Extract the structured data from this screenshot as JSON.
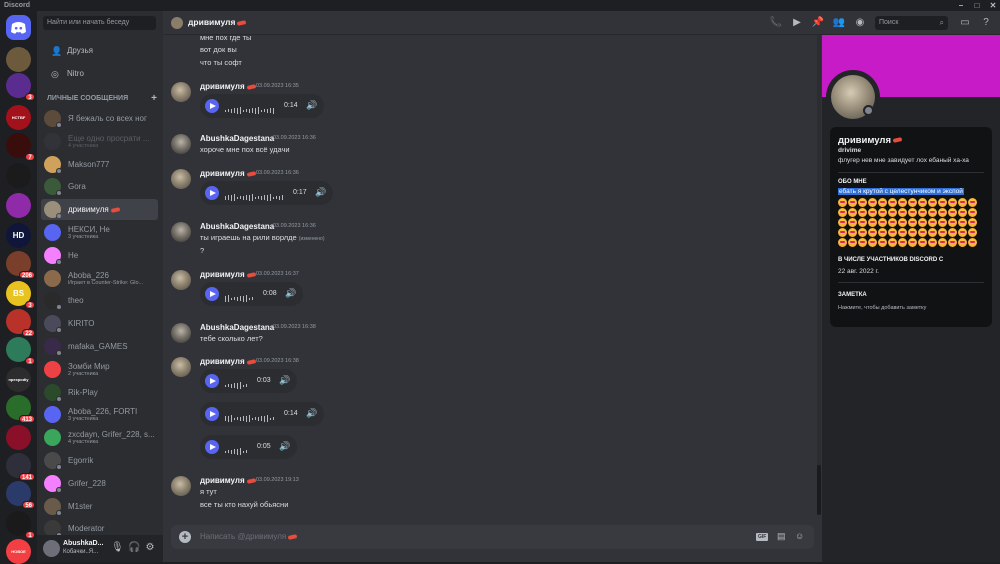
{
  "app": {
    "title": "Discord"
  },
  "servers": [
    {
      "color": "#6d5a3c",
      "badge": ""
    },
    {
      "color": "#5b2c8f",
      "badge": "3"
    },
    {
      "color": "#a3121b",
      "badge": "",
      "label": "HCTBF"
    },
    {
      "color": "#3a0d0d",
      "badge": "7"
    },
    {
      "color": "#1b1b1b",
      "badge": ""
    },
    {
      "color": "#8f2aa8",
      "badge": ""
    },
    {
      "color": "#10163a",
      "badge": "",
      "label": "HD"
    },
    {
      "color": "#7a3f2a",
      "badge": "206"
    },
    {
      "color": "#e8c21e",
      "badge": "3",
      "label": "BS"
    },
    {
      "color": "#b8322a",
      "badge": "22"
    },
    {
      "color": "#2d7b5a",
      "badge": "1"
    },
    {
      "color": "#2c2c2c",
      "badge": "",
      "label": "npexpodiy"
    },
    {
      "color": "#2a6d2a",
      "badge": "413"
    },
    {
      "color": "#8a1029",
      "badge": ""
    },
    {
      "color": "#2f2f3c",
      "badge": "141"
    },
    {
      "color": "#2a3b6a",
      "badge": "56"
    },
    {
      "color": "#1a1a1a",
      "badge": "1"
    },
    {
      "color": "#f23f43",
      "badge": "",
      "label": "НОВОЕ"
    }
  ],
  "dm_sidebar": {
    "search_placeholder": "Найти или начать беседу",
    "friends_label": "Друзья",
    "nitro_label": "Nitro",
    "dm_header": "ЛИЧНЫЕ СООБЩЕНИЯ",
    "items": [
      {
        "name": "Я бежаль со всех ног",
        "sub": "",
        "color": "#5c4a3a",
        "active": false
      },
      {
        "name": "Еще одно просрати ...",
        "sub": "4 участника",
        "color": "#3a3c42",
        "active": false
      },
      {
        "name": "Makson777",
        "sub": "",
        "color": "#cfa15a",
        "active": false
      },
      {
        "name": "Gora",
        "sub": "",
        "color": "#3a5a3a",
        "active": false
      },
      {
        "name": "дривимуля",
        "sub": "",
        "color": "#9a8f7b",
        "active": true
      },
      {
        "name": "НЕКСИ, Не",
        "sub": "3 участника",
        "color": "#5865f2",
        "active": false
      },
      {
        "name": "Не",
        "sub": "",
        "color": "#f47fff",
        "active": false
      },
      {
        "name": "Aboba_226",
        "sub": "Играет в Counter-Strike: Glo...",
        "color": "#8a6a4a",
        "active": false
      },
      {
        "name": "theo",
        "sub": "",
        "color": "#2a2a2a",
        "active": false
      },
      {
        "name": "KIRITO",
        "sub": "",
        "color": "#4a4a5a",
        "active": false
      },
      {
        "name": "mafaka_GAMES",
        "sub": "",
        "color": "#3a2a4a",
        "active": false
      },
      {
        "name": "Зомби Мир",
        "sub": "2 участника",
        "color": "#ed4245",
        "active": false
      },
      {
        "name": "Rik-Play",
        "sub": "",
        "color": "#2a4a2a",
        "active": false
      },
      {
        "name": "Aboba_226, FORTI",
        "sub": "3 участника",
        "color": "#5865f2",
        "active": false
      },
      {
        "name": "zxcdayn, Grifer_228, s...",
        "sub": "4 участника",
        "color": "#3ba55c",
        "active": false
      },
      {
        "name": "Egorrik",
        "sub": "",
        "color": "#4a4a4a",
        "active": false
      },
      {
        "name": "Grifer_228",
        "sub": "",
        "color": "#f47fff",
        "active": false
      },
      {
        "name": "M1ster",
        "sub": "",
        "color": "#6a5a4a",
        "active": false
      },
      {
        "name": "Moderator",
        "sub": "",
        "color": "#3a3a3a",
        "active": false
      }
    ]
  },
  "user_panel": {
    "name": "AbushkaD...",
    "status": "Кобачки..Я..."
  },
  "header": {
    "title": "дривимуля",
    "search_placeholder": "Поиск"
  },
  "chat": {
    "top_lines": [
      "мне пох где ты",
      "вот док вы",
      "что ты софт"
    ],
    "messages": [
      {
        "author": "дривимуля",
        "time": "03.09.2023 16:35",
        "kind": "driv",
        "voice": [
          {
            "duration": "0:14"
          }
        ]
      },
      {
        "author": "AbushkaDagestana",
        "time": "03.09.2023 16:36",
        "kind": "abu",
        "lines": [
          "хороче мне пох всё удачи"
        ]
      },
      {
        "author": "дривимуля",
        "time": "03.09.2023 16:36",
        "kind": "driv",
        "voice": [
          {
            "duration": "0:17"
          }
        ]
      },
      {
        "author": "AbushkaDagestana",
        "time": "03.09.2023 16:36",
        "kind": "abu",
        "lines": [
          "ты играешь на рили ворлде",
          "?"
        ],
        "edited": "(изменено)"
      },
      {
        "author": "дривимуля",
        "time": "03.09.2023 16:37",
        "kind": "driv",
        "voice": [
          {
            "duration": "0:08"
          }
        ]
      },
      {
        "author": "AbushkaDagestana",
        "time": "03.09.2023 16:38",
        "kind": "abu",
        "lines": [
          "тебе сколько лет?"
        ]
      },
      {
        "author": "дривимуля",
        "time": "03.09.2023 16:38",
        "kind": "driv",
        "voice": [
          {
            "duration": "0:03"
          },
          {
            "duration": "0:14"
          },
          {
            "duration": "0:05"
          }
        ]
      },
      {
        "author": "дривимуля",
        "time": "03.09.2023 19:13",
        "kind": "driv",
        "lines": [
          "я тут",
          "все ты кто нахуй обьясни"
        ]
      }
    ],
    "composer_placeholder": "Написать @дривимуля",
    "gif_label": "GIF"
  },
  "profile": {
    "banner_color": "#c81bc8",
    "display_name": "дривимуля",
    "username": "drivime",
    "custom_status": "флугер нев мне завидует лох ебаный ха-ха",
    "about_header": "ОБО МНЕ",
    "about_text": "ебать я крутой с целестунчиком и экспой",
    "member_header": "В ЧИСЛЕ УЧАСТНИКОВ DISCORD С",
    "member_since": "22 авг. 2022 г.",
    "note_header": "ЗАМЕТКА",
    "note_placeholder": "Нажмите, чтобы добавить заметку"
  }
}
